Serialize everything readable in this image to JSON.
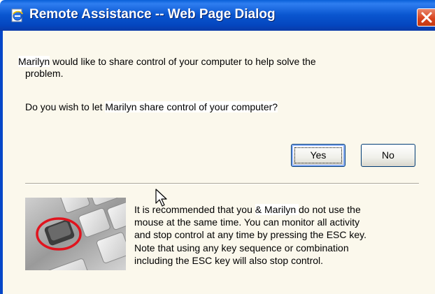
{
  "titlebar": {
    "title": "Remote Assistance -- Web Page Dialog",
    "icon": "ie-page-icon",
    "close_icon": "close-icon"
  },
  "message": {
    "requester_name": "Marilyn",
    "line1_rest": " would like to share control of your computer to help solve the",
    "line2": "problem.",
    "question_prefix": "Do you wish to let ",
    "question_name": "Marilyn",
    "question_suffix": " share control of your computer?"
  },
  "buttons": {
    "yes_label": "Yes",
    "no_label": "No"
  },
  "info": {
    "image": "keyboard-esc-key-image",
    "line1_prefix": "It is recommended that you ",
    "line1_name": " & Marilyn ",
    "line1_suffix": " do not use the",
    "line2": "mouse at the same time. You can monitor all activity",
    "line3": "and stop control at any time by pressing the ESC key.",
    "line4": "Note that using any key sequence or combination",
    "line5": "including the ESC key will also stop control."
  },
  "colors": {
    "titlebar_blue": "#0a56d0",
    "client_bg": "#fbf8ec",
    "close_red": "#d9441f",
    "button_border": "#003c74"
  }
}
